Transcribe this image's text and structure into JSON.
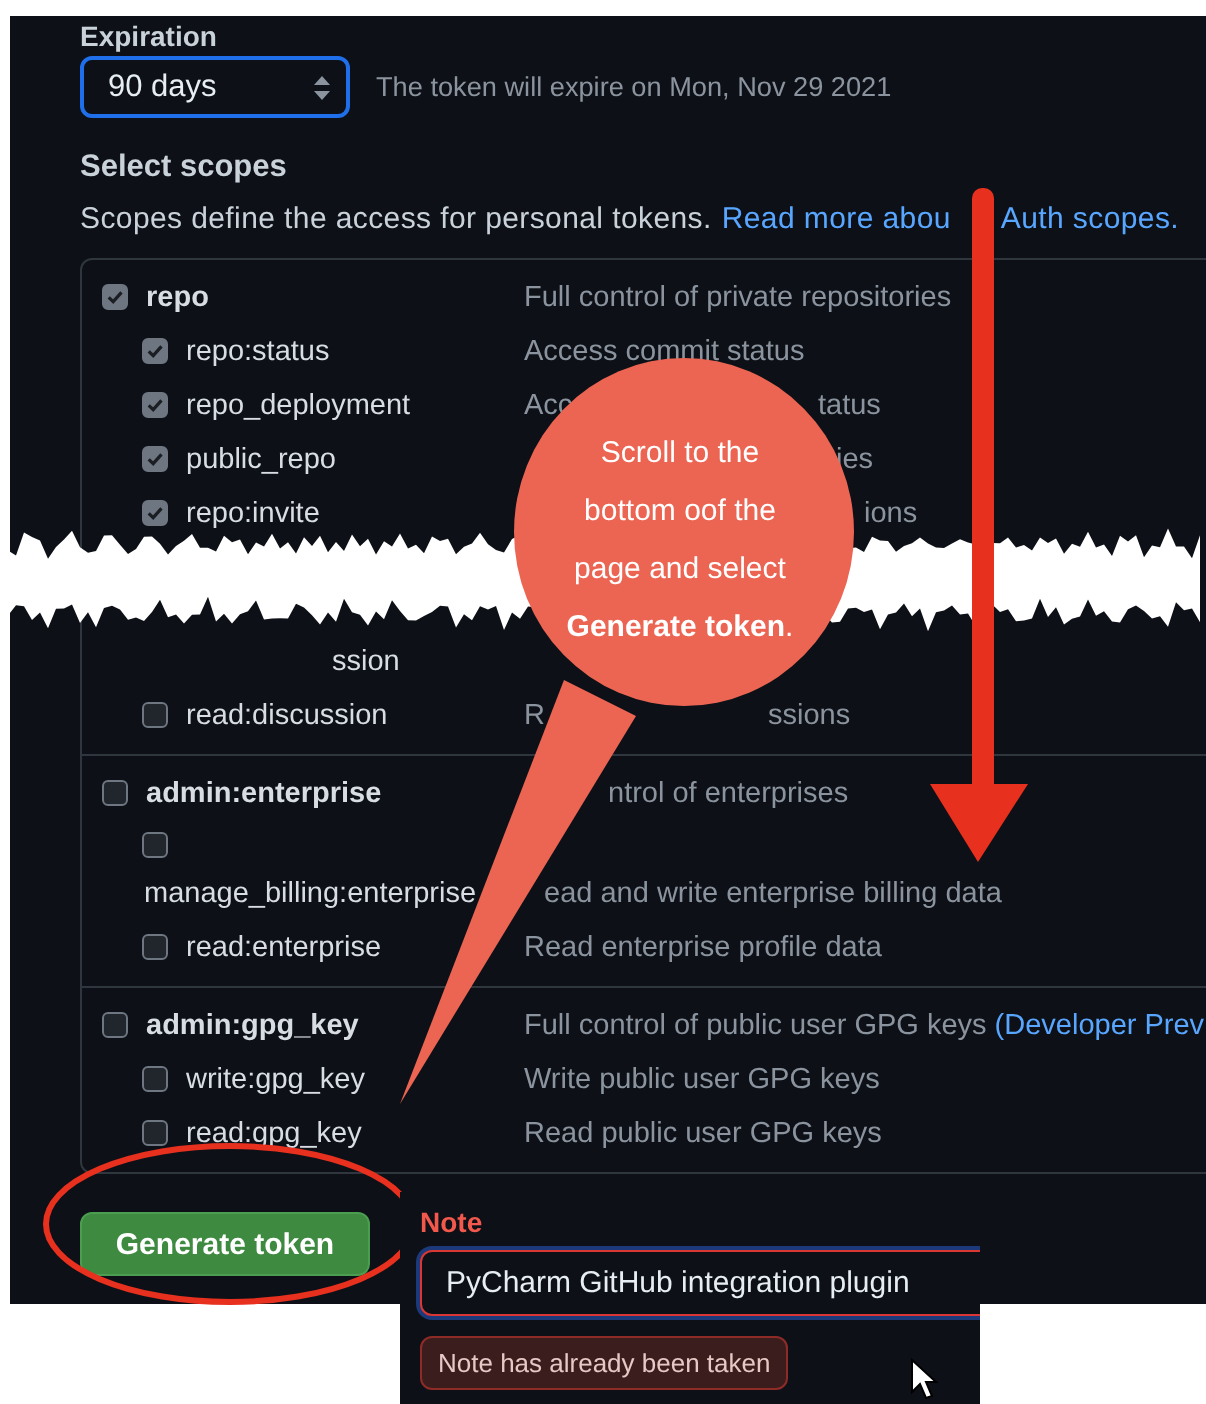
{
  "expiration": {
    "label": "Expiration",
    "value": "90 days",
    "hint": "The token will expire on Mon, Nov 29 2021"
  },
  "scopes": {
    "title": "Select scopes",
    "intro": "Scopes define the access for personal tokens.",
    "link_parts": [
      "Read more abou",
      "Auth scopes."
    ],
    "groups": [
      {
        "name": "repo",
        "checked": true,
        "description": "Full control of private repositories",
        "children": [
          {
            "kind": "normal",
            "name": "repo:status",
            "checked": true,
            "description": "Access commit status"
          },
          {
            "kind": "normal",
            "name": "repo_deployment",
            "checked": true,
            "description": "Acc",
            "description_tail": "tatus"
          },
          {
            "kind": "normal",
            "name": "public_repo",
            "checked": true,
            "description_tail": "ies"
          },
          {
            "kind": "normal",
            "name": "repo:invite",
            "checked": true,
            "description_tail": "ions"
          },
          {
            "kind": "fragment",
            "name": "ssion"
          },
          {
            "kind": "normal",
            "name": "read:discussion",
            "checked": false,
            "description": "R",
            "description_tail": "ssions"
          }
        ]
      },
      {
        "name": "admin:enterprise",
        "checked": false,
        "description_tail": "ntrol of enterprises",
        "children": [
          {
            "kind": "wrapped",
            "name": "manage_billing:enterprise",
            "checked": false,
            "description_tail": "ead and write enterprise billing data"
          },
          {
            "kind": "normal",
            "name": "read:enterprise",
            "checked": false,
            "description": "Read enterprise profile data"
          }
        ]
      },
      {
        "name": "admin:gpg_key",
        "checked": false,
        "description": "Full control of public user GPG keys",
        "link": "(Developer Prev",
        "children": [
          {
            "kind": "normal",
            "name": "write:gpg_key",
            "checked": false,
            "description": "Write public user GPG keys"
          },
          {
            "kind": "normal",
            "name": "read:gpg_key",
            "checked": false,
            "description": "Read public user GPG keys"
          }
        ]
      }
    ]
  },
  "generate_button": "Generate token",
  "note": {
    "label": "Note",
    "value": "PyCharm GitHub integration plugin",
    "error": "Note has already been taken"
  },
  "callout": "Scroll to the bottom oof the page and select **Generate token**."
}
